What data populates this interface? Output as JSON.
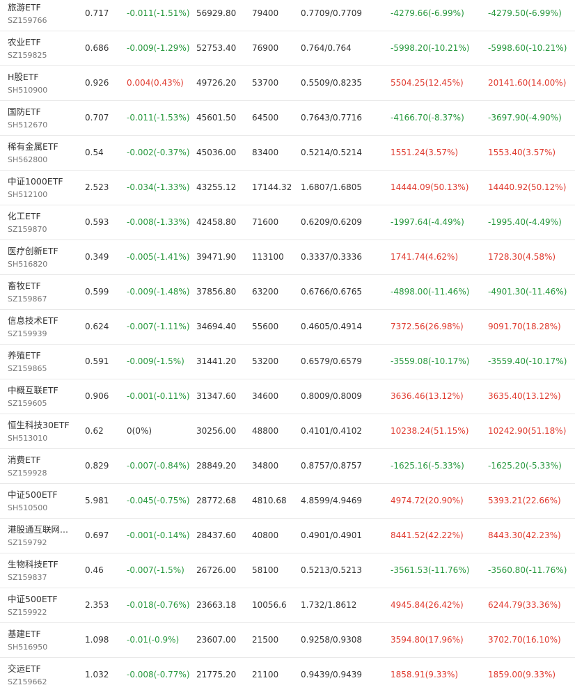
{
  "colors": {
    "up": "#e03a2f",
    "down": "#27983d",
    "flat": "#333333",
    "divider": "#e9e9e9"
  },
  "rows": [
    {
      "name": "旅游ETF",
      "code": "SZ159766",
      "price": "0.717",
      "change": "-0.011(-1.51%)",
      "value": "56929.80",
      "shares": "79400",
      "cost": "0.7709/0.7709",
      "pnl1": "-4279.66(-6.99%)",
      "pnl2": "-4279.50(-6.99%)",
      "change_dir": "down",
      "pnl1_dir": "down",
      "pnl2_dir": "down"
    },
    {
      "name": "农业ETF",
      "code": "SZ159825",
      "price": "0.686",
      "change": "-0.009(-1.29%)",
      "value": "52753.40",
      "shares": "76900",
      "cost": "0.764/0.764",
      "pnl1": "-5998.20(-10.21%)",
      "pnl2": "-5998.60(-10.21%)",
      "change_dir": "down",
      "pnl1_dir": "down",
      "pnl2_dir": "down"
    },
    {
      "name": "H股ETF",
      "code": "SH510900",
      "price": "0.926",
      "change": "0.004(0.43%)",
      "value": "49726.20",
      "shares": "53700",
      "cost": "0.5509/0.8235",
      "pnl1": "5504.25(12.45%)",
      "pnl2": "20141.60(14.00%)",
      "change_dir": "up",
      "pnl1_dir": "up",
      "pnl2_dir": "up"
    },
    {
      "name": "国防ETF",
      "code": "SH512670",
      "price": "0.707",
      "change": "-0.011(-1.53%)",
      "value": "45601.50",
      "shares": "64500",
      "cost": "0.7643/0.7716",
      "pnl1": "-4166.70(-8.37%)",
      "pnl2": "-3697.90(-4.90%)",
      "change_dir": "down",
      "pnl1_dir": "down",
      "pnl2_dir": "down"
    },
    {
      "name": "稀有金属ETF",
      "code": "SH562800",
      "price": "0.54",
      "change": "-0.002(-0.37%)",
      "value": "45036.00",
      "shares": "83400",
      "cost": "0.5214/0.5214",
      "pnl1": "1551.24(3.57%)",
      "pnl2": "1553.40(3.57%)",
      "change_dir": "down",
      "pnl1_dir": "up",
      "pnl2_dir": "up"
    },
    {
      "name": "中证1000ETF",
      "code": "SH512100",
      "price": "2.523",
      "change": "-0.034(-1.33%)",
      "value": "43255.12",
      "shares": "17144.32",
      "cost": "1.6807/1.6805",
      "pnl1": "14444.09(50.13%)",
      "pnl2": "14440.92(50.12%)",
      "change_dir": "down",
      "pnl1_dir": "up",
      "pnl2_dir": "up"
    },
    {
      "name": "化工ETF",
      "code": "SZ159870",
      "price": "0.593",
      "change": "-0.008(-1.33%)",
      "value": "42458.80",
      "shares": "71600",
      "cost": "0.6209/0.6209",
      "pnl1": "-1997.64(-4.49%)",
      "pnl2": "-1995.40(-4.49%)",
      "change_dir": "down",
      "pnl1_dir": "down",
      "pnl2_dir": "down"
    },
    {
      "name": "医疗创新ETF",
      "code": "SH516820",
      "price": "0.349",
      "change": "-0.005(-1.41%)",
      "value": "39471.90",
      "shares": "113100",
      "cost": "0.3337/0.3336",
      "pnl1": "1741.74(4.62%)",
      "pnl2": "1728.30(4.58%)",
      "change_dir": "down",
      "pnl1_dir": "up",
      "pnl2_dir": "up"
    },
    {
      "name": "畜牧ETF",
      "code": "SZ159867",
      "price": "0.599",
      "change": "-0.009(-1.48%)",
      "value": "37856.80",
      "shares": "63200",
      "cost": "0.6766/0.6765",
      "pnl1": "-4898.00(-11.46%)",
      "pnl2": "-4901.30(-11.46%)",
      "change_dir": "down",
      "pnl1_dir": "down",
      "pnl2_dir": "down"
    },
    {
      "name": "信息技术ETF",
      "code": "SZ159939",
      "price": "0.624",
      "change": "-0.007(-1.11%)",
      "value": "34694.40",
      "shares": "55600",
      "cost": "0.4605/0.4914",
      "pnl1": "7372.56(26.98%)",
      "pnl2": "9091.70(18.28%)",
      "change_dir": "down",
      "pnl1_dir": "up",
      "pnl2_dir": "up"
    },
    {
      "name": "养殖ETF",
      "code": "SZ159865",
      "price": "0.591",
      "change": "-0.009(-1.5%)",
      "value": "31441.20",
      "shares": "53200",
      "cost": "0.6579/0.6579",
      "pnl1": "-3559.08(-10.17%)",
      "pnl2": "-3559.40(-10.17%)",
      "change_dir": "down",
      "pnl1_dir": "down",
      "pnl2_dir": "down"
    },
    {
      "name": "中概互联ETF",
      "code": "SZ159605",
      "price": "0.906",
      "change": "-0.001(-0.11%)",
      "value": "31347.60",
      "shares": "34600",
      "cost": "0.8009/0.8009",
      "pnl1": "3636.46(13.12%)",
      "pnl2": "3635.40(13.12%)",
      "change_dir": "down",
      "pnl1_dir": "up",
      "pnl2_dir": "up"
    },
    {
      "name": "恒生科技30ETF",
      "code": "SH513010",
      "price": "0.62",
      "change": "0(0%)",
      "value": "30256.00",
      "shares": "48800",
      "cost": "0.4101/0.4102",
      "pnl1": "10238.24(51.15%)",
      "pnl2": "10242.90(51.18%)",
      "change_dir": "flat",
      "pnl1_dir": "up",
      "pnl2_dir": "up"
    },
    {
      "name": "消费ETF",
      "code": "SZ159928",
      "price": "0.829",
      "change": "-0.007(-0.84%)",
      "value": "28849.20",
      "shares": "34800",
      "cost": "0.8757/0.8757",
      "pnl1": "-1625.16(-5.33%)",
      "pnl2": "-1625.20(-5.33%)",
      "change_dir": "down",
      "pnl1_dir": "down",
      "pnl2_dir": "down"
    },
    {
      "name": "中证500ETF",
      "code": "SH510500",
      "price": "5.981",
      "change": "-0.045(-0.75%)",
      "value": "28772.68",
      "shares": "4810.68",
      "cost": "4.8599/4.9469",
      "pnl1": "4974.72(20.90%)",
      "pnl2": "5393.21(22.66%)",
      "change_dir": "down",
      "pnl1_dir": "up",
      "pnl2_dir": "up"
    },
    {
      "name": "港股通互联网...",
      "code": "SZ159792",
      "price": "0.697",
      "change": "-0.001(-0.14%)",
      "value": "28437.60",
      "shares": "40800",
      "cost": "0.4901/0.4901",
      "pnl1": "8441.52(42.22%)",
      "pnl2": "8443.30(42.23%)",
      "change_dir": "down",
      "pnl1_dir": "up",
      "pnl2_dir": "up"
    },
    {
      "name": "生物科技ETF",
      "code": "SZ159837",
      "price": "0.46",
      "change": "-0.007(-1.5%)",
      "value": "26726.00",
      "shares": "58100",
      "cost": "0.5213/0.5213",
      "pnl1": "-3561.53(-11.76%)",
      "pnl2": "-3560.80(-11.76%)",
      "change_dir": "down",
      "pnl1_dir": "down",
      "pnl2_dir": "down"
    },
    {
      "name": "中证500ETF",
      "code": "SZ159922",
      "price": "2.353",
      "change": "-0.018(-0.76%)",
      "value": "23663.18",
      "shares": "10056.6",
      "cost": "1.732/1.8612",
      "pnl1": "4945.84(26.42%)",
      "pnl2": "6244.79(33.36%)",
      "change_dir": "down",
      "pnl1_dir": "up",
      "pnl2_dir": "up"
    },
    {
      "name": "基建ETF",
      "code": "SH516950",
      "price": "1.098",
      "change": "-0.01(-0.9%)",
      "value": "23607.00",
      "shares": "21500",
      "cost": "0.9258/0.9308",
      "pnl1": "3594.80(17.96%)",
      "pnl2": "3702.70(16.10%)",
      "change_dir": "down",
      "pnl1_dir": "up",
      "pnl2_dir": "up"
    },
    {
      "name": "交运ETF",
      "code": "SZ159662",
      "price": "1.032",
      "change": "-0.008(-0.77%)",
      "value": "21775.20",
      "shares": "21100",
      "cost": "0.9439/0.9439",
      "pnl1": "1858.91(9.33%)",
      "pnl2": "1859.00(9.33%)",
      "change_dir": "down",
      "pnl1_dir": "up",
      "pnl2_dir": "up"
    }
  ]
}
